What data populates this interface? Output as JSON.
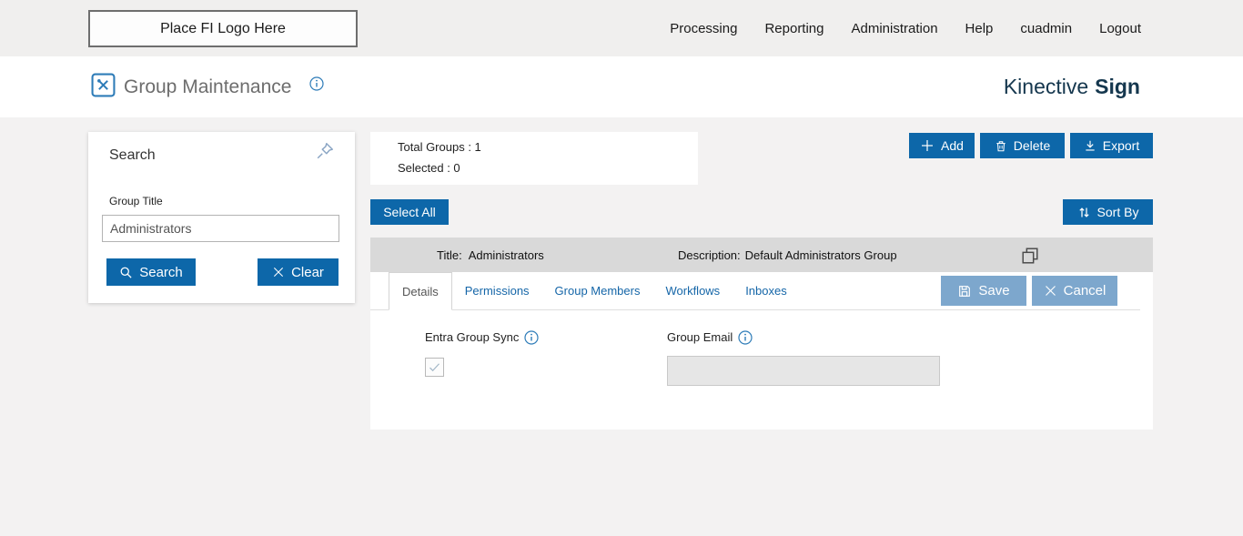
{
  "topbar": {
    "logo_text": "Place FI Logo Here",
    "nav": [
      {
        "label": "Processing"
      },
      {
        "label": "Reporting"
      },
      {
        "label": "Administration"
      },
      {
        "label": "Help"
      },
      {
        "label": "cuadmin"
      },
      {
        "label": "Logout"
      }
    ]
  },
  "header": {
    "title": "Group Maintenance",
    "brand": {
      "first": "Kinective",
      "second": "Sign"
    }
  },
  "search_panel": {
    "title": "Search",
    "group_title_label": "Group Title",
    "group_title_value": "Administrators",
    "search_button": "Search",
    "clear_button": "Clear"
  },
  "summary": {
    "total_groups": "Total Groups : 1",
    "selected": "Selected : 0"
  },
  "toolbar": {
    "add": "Add",
    "delete": "Delete",
    "export": "Export",
    "select_all": "Select All",
    "sort_by": "Sort By"
  },
  "group_row": {
    "title_label": "Title:",
    "title_value": "Administrators",
    "description_label": "Description:",
    "description_value": "Default Administrators Group"
  },
  "tabs": [
    {
      "label": "Details",
      "active": true
    },
    {
      "label": "Permissions",
      "active": false
    },
    {
      "label": "Group Members",
      "active": false
    },
    {
      "label": "Workflows",
      "active": false
    },
    {
      "label": "Inboxes",
      "active": false
    }
  ],
  "detail_actions": {
    "save": "Save",
    "cancel": "Cancel"
  },
  "details_form": {
    "entra_group_sync_label": "Entra Group Sync",
    "entra_group_sync_checked": true,
    "group_email_label": "Group Email",
    "group_email_value": ""
  },
  "colors": {
    "primary_button": "#0d67a9",
    "muted_button": "#7da7cd",
    "brand_text": "#15374e",
    "row_header_bg": "#d9d9d9"
  }
}
